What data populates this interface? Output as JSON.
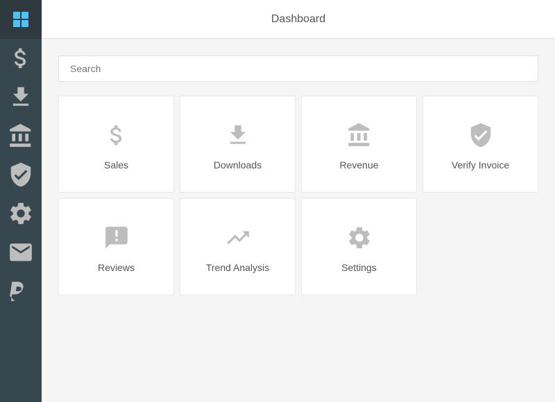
{
  "header": {
    "title": "Dashboard"
  },
  "search": {
    "placeholder": "Search",
    "value": ""
  },
  "sidebar": {
    "items": [
      {
        "name": "dollar-icon",
        "label": "Sales"
      },
      {
        "name": "download-icon",
        "label": "Downloads"
      },
      {
        "name": "bank-icon",
        "label": "Revenue"
      },
      {
        "name": "shield-icon",
        "label": "Verify Invoice"
      },
      {
        "name": "settings-icon",
        "label": "Settings"
      },
      {
        "name": "mail-icon",
        "label": "Mail"
      },
      {
        "name": "paypal-icon",
        "label": "Paypal"
      }
    ]
  },
  "cards": [
    {
      "id": "sales",
      "label": "Sales",
      "icon": "dollar"
    },
    {
      "id": "downloads",
      "label": "Downloads",
      "icon": "download"
    },
    {
      "id": "revenue",
      "label": "Revenue",
      "icon": "bank"
    },
    {
      "id": "verify-invoice",
      "label": "Verify Invoice",
      "icon": "shield"
    },
    {
      "id": "reviews",
      "label": "Reviews",
      "icon": "reviews"
    },
    {
      "id": "trend-analysis",
      "label": "Trend Analysis",
      "icon": "trend"
    },
    {
      "id": "settings",
      "label": "Settings",
      "icon": "settings"
    }
  ]
}
